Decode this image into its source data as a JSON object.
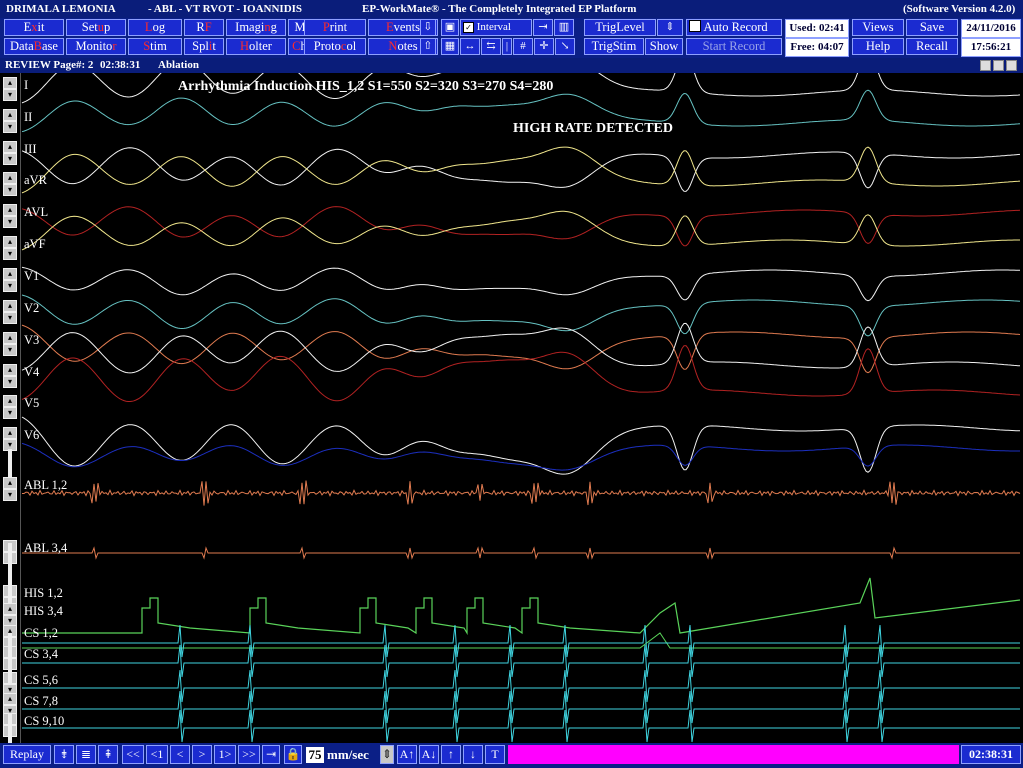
{
  "title_bar": {
    "patient": "DRIMALA LEMONIA",
    "study": "- ABL - VT RVOT - IOANNIDIS",
    "app": "EP-WorkMate® - The Completely Integrated EP Platform",
    "version": "(Software Version 4.2.0)"
  },
  "toolbar": {
    "row1": [
      {
        "pre": "E",
        "hot": "x",
        "post": "it"
      },
      {
        "pre": "Set",
        "hot": "u",
        "post": "p"
      },
      {
        "pre": "",
        "hot": "L",
        "post": "og"
      },
      {
        "pre": "R",
        "hot": "F",
        "post": ""
      },
      {
        "pre": "Imagi",
        "hot": "n",
        "post": "g"
      },
      {
        "pre": "M",
        "hot": "a",
        "post": "p"
      },
      {
        "pre": "",
        "hot": "P",
        "post": "rint"
      },
      {
        "pre": "",
        "hot": "E",
        "post": "vents"
      }
    ],
    "row2": [
      {
        "pre": "Data",
        "hot": "B",
        "post": "ase"
      },
      {
        "pre": "Monito",
        "hot": "r",
        "post": ""
      },
      {
        "pre": "",
        "hot": "S",
        "post": "tim"
      },
      {
        "pre": "Spl",
        "hot": "i",
        "post": "t"
      },
      {
        "pre": "",
        "hot": "H",
        "post": "olter"
      },
      {
        "pre": "",
        "hot": "C",
        "post": "hart"
      },
      {
        "pre": "Proto",
        "hot": "c",
        "post": "ol"
      },
      {
        "pre": "",
        "hot": "N",
        "post": "otes"
      }
    ],
    "interval_label": "Interval",
    "triglevel_label": "TrigLevel",
    "trigstim_label": "TrigStim",
    "show_label": "Show",
    "auto_record_label": "Auto Record",
    "start_record_label": "Start Record",
    "used_label": "Used: 02:41",
    "free_label": "Free: 04:07",
    "views_label": "Views",
    "save_label": "Save",
    "help_label": "Help",
    "recall_label": "Recall",
    "date": "24/11/2016",
    "time": "17:56:21"
  },
  "subbar": {
    "mode": "REVIEW Page#: 2",
    "time": "02:38:31",
    "procedure": "Ablation"
  },
  "plot": {
    "title": "Arrhythmia Induction HIS_1,2 S1=550 S2=320 S3=270 S4=280",
    "alert": "HIGH RATE DETECTED",
    "channels": [
      "I",
      "II",
      "III",
      "aVR",
      "AVL",
      "aVF",
      "V1",
      "V2",
      "V3",
      "V4",
      "V5",
      "V6",
      "ABL 1,2",
      "ABL 3,4",
      "HIS 1,2",
      "HIS 3,4",
      "CS 1,2",
      "CS 3,4",
      "CS 5,6",
      "CS 7,8",
      "CS 9,10"
    ]
  },
  "bottom": {
    "replay_label": "Replay",
    "prev_page": "<<",
    "prev_1": "<1",
    "prev": "<",
    "next": ">",
    "next_1": "1>",
    "next_page": ">>",
    "speed_value": "75",
    "speed_unit": "mm/sec",
    "t_label": "T",
    "clock": "02:38:31"
  },
  "colors": {
    "titlebar": "#0a1d7a",
    "button": "#1b2bd0",
    "hotkey": "#ff2b2b",
    "magenta_bar": "#ff00ff",
    "ecg_white": "#f2f2f2",
    "ecg_yellow": "#f0e68c",
    "ecg_cyan": "#66c2c2",
    "ecg_red": "#b22222",
    "ecg_orange": "#e07b50",
    "ecg_blue": "#1c2fbf",
    "his_green": "#5ad35a",
    "cs_cyan": "#3fd4e0"
  }
}
